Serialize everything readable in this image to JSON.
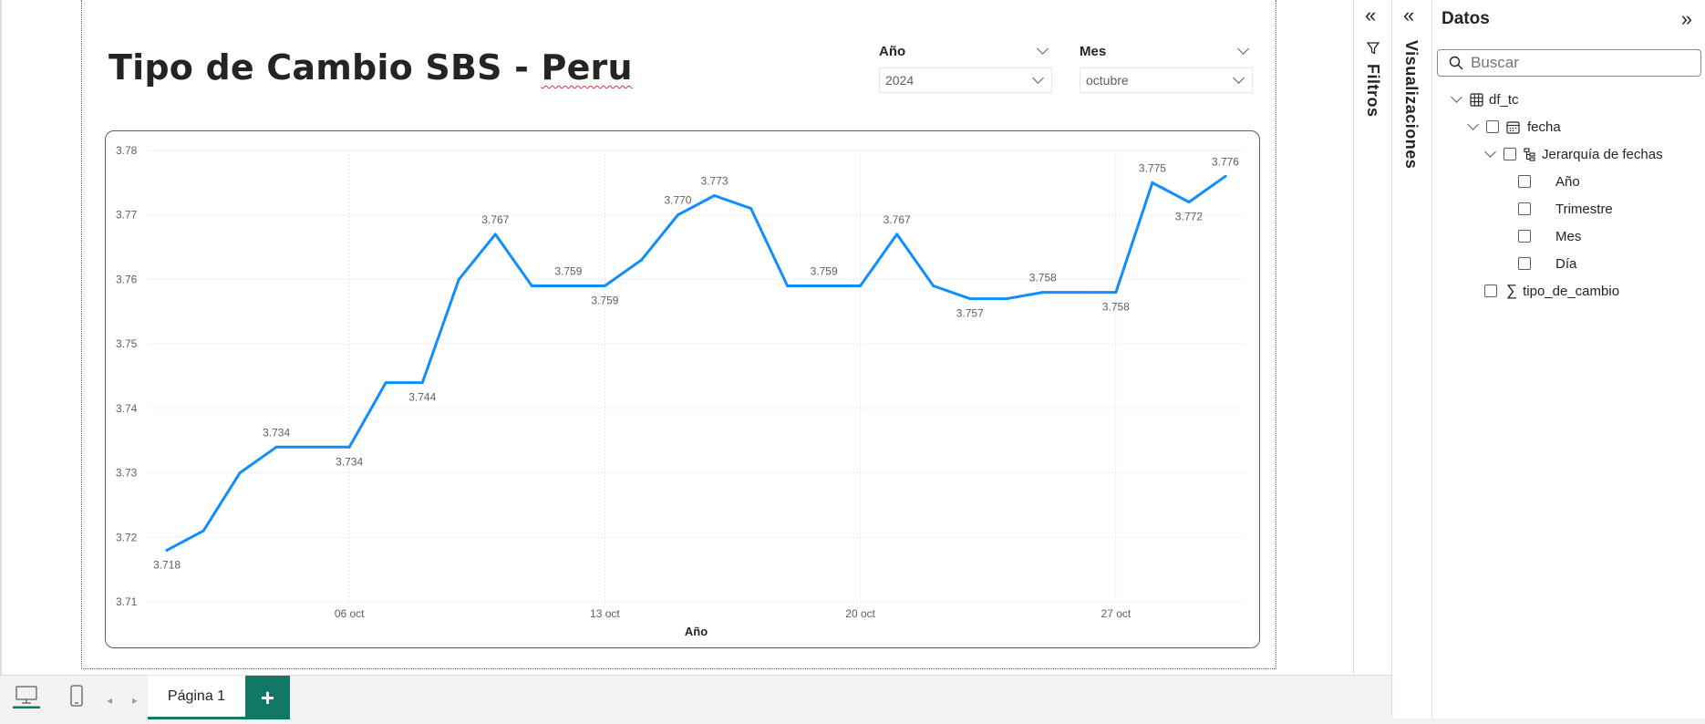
{
  "report": {
    "title_main": "Tipo de Cambio SBS - ",
    "title_tail": "Peru"
  },
  "slicers": {
    "year": {
      "label": "Año",
      "value": "2024"
    },
    "month": {
      "label": "Mes",
      "value": "octubre"
    }
  },
  "panes": {
    "filters_label": "Filtros",
    "visualizations_label": "Visualizaciones",
    "data_label": "Datos",
    "search_placeholder": "Buscar"
  },
  "fields": {
    "table": "df_tc",
    "date_field": "fecha",
    "hierarchy": "Jerarquía de fechas",
    "levels": [
      "Año",
      "Trimestre",
      "Mes",
      "Día"
    ],
    "measure": "tipo_de_cambio"
  },
  "pages": {
    "active_tab": "Página 1",
    "add_label": "+"
  },
  "icons": {
    "desktop": "desktop-view-icon",
    "mobile": "mobile-view-icon",
    "filter": "filter-icon",
    "table": "table-icon",
    "calendar": "calendar-icon",
    "hierarchy": "hierarchy-icon",
    "sigma": "sigma-icon",
    "search": "search-icon"
  },
  "colors": {
    "line": "#118DFF",
    "accent": "#117865"
  },
  "chart_data": {
    "type": "line",
    "title": "",
    "xlabel": "Año",
    "ylabel": "",
    "ylim": [
      3.71,
      3.78
    ],
    "yticks": [
      "3.71",
      "3.72",
      "3.73",
      "3.74",
      "3.75",
      "3.76",
      "3.77",
      "3.78"
    ],
    "xticks": [
      "06 oct",
      "13 oct",
      "20 oct",
      "27 oct"
    ],
    "xtick_days": [
      6,
      13,
      20,
      27
    ],
    "grid": true,
    "series": [
      {
        "days": [
          1,
          2,
          3,
          4,
          5,
          6,
          7,
          8,
          9,
          10,
          11,
          12,
          13,
          14,
          15,
          16,
          17,
          18,
          19,
          20,
          21,
          22,
          23,
          24,
          25,
          26,
          27,
          28,
          29,
          30
        ],
        "values": [
          3.718,
          3.721,
          3.73,
          3.734,
          3.734,
          3.734,
          3.744,
          3.744,
          3.76,
          3.767,
          3.759,
          3.759,
          3.759,
          3.763,
          3.77,
          3.773,
          3.771,
          3.759,
          3.759,
          3.759,
          3.767,
          3.759,
          3.757,
          3.757,
          3.758,
          3.758,
          3.758,
          3.775,
          3.772,
          3.776
        ]
      }
    ],
    "data_labels": [
      {
        "day": 1,
        "text": "3.718",
        "pos": "below"
      },
      {
        "day": 4,
        "text": "3.734",
        "pos": "above"
      },
      {
        "day": 6,
        "text": "3.734",
        "pos": "below"
      },
      {
        "day": 8,
        "text": "3.744",
        "pos": "below"
      },
      {
        "day": 10,
        "text": "3.767",
        "pos": "above"
      },
      {
        "day": 12,
        "text": "3.759",
        "pos": "above"
      },
      {
        "day": 13,
        "text": "3.759",
        "pos": "below"
      },
      {
        "day": 15,
        "text": "3.770",
        "pos": "above"
      },
      {
        "day": 16,
        "text": "3.773",
        "pos": "above"
      },
      {
        "day": 19,
        "text": "3.759",
        "pos": "above"
      },
      {
        "day": 21,
        "text": "3.767",
        "pos": "above"
      },
      {
        "day": 23,
        "text": "3.757",
        "pos": "below"
      },
      {
        "day": 25,
        "text": "3.758",
        "pos": "above"
      },
      {
        "day": 27,
        "text": "3.758",
        "pos": "below"
      },
      {
        "day": 28,
        "text": "3.775",
        "pos": "above"
      },
      {
        "day": 29,
        "text": "3.772",
        "pos": "below"
      },
      {
        "day": 30,
        "text": "3.776",
        "pos": "above"
      }
    ]
  }
}
